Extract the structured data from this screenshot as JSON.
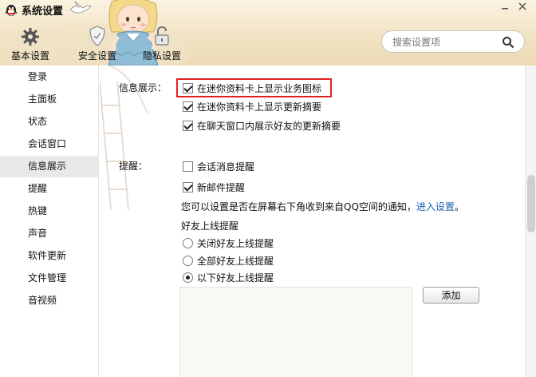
{
  "window": {
    "title": "系统设置"
  },
  "toolbar": {
    "basic": "基本设置",
    "security": "安全设置",
    "privacy": "隐私设置"
  },
  "search": {
    "placeholder": "搜索设置项"
  },
  "sidebar": {
    "items": [
      {
        "label": "登录"
      },
      {
        "label": "主面板"
      },
      {
        "label": "状态"
      },
      {
        "label": "会话窗口"
      },
      {
        "label": "信息展示",
        "active": true
      },
      {
        "label": "提醒"
      },
      {
        "label": "热键"
      },
      {
        "label": "声音"
      },
      {
        "label": "软件更新"
      },
      {
        "label": "文件管理"
      },
      {
        "label": "音视频"
      }
    ]
  },
  "info_display": {
    "label": "信息展示：",
    "options": [
      {
        "label": "在迷你资料卡上显示业务图标",
        "checked": true
      },
      {
        "label": "在迷你资料卡上显示更新摘要",
        "checked": true
      },
      {
        "label": "在聊天窗口内展示好友的更新摘要",
        "checked": true
      }
    ]
  },
  "reminder": {
    "label": "提醒：",
    "options": [
      {
        "label": "会话消息提醒",
        "checked": false
      },
      {
        "label": "新邮件提醒",
        "checked": true
      }
    ],
    "note": "您可以设置是否在屏幕右下角收到来自QQ空间的通知，",
    "note_link": "进入设置",
    "note_end": "。",
    "friend_online_title": "好友上线提醒",
    "radios": [
      {
        "label": "关闭好友上线提醒",
        "checked": false
      },
      {
        "label": "全部好友上线提醒",
        "checked": false
      },
      {
        "label": "以下好友上线提醒",
        "checked": true
      }
    ],
    "add_button": "添加"
  },
  "colors": {
    "highlight": "#e02020",
    "link": "#1a5fb4",
    "active_nav": "#e9e9e9"
  }
}
